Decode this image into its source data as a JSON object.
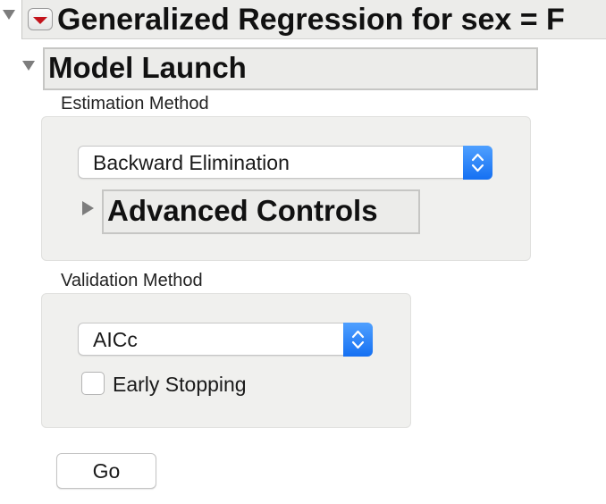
{
  "report": {
    "title": "Generalized Regression for sex = F",
    "menu_icon": "red-triangle-menu-icon",
    "disclosure_icon": "disclosure-triangle-expanded-icon"
  },
  "model_launch": {
    "title": "Model Launch",
    "estimation": {
      "label": "Estimation Method",
      "selected": "Backward Elimination"
    },
    "advanced_controls": {
      "title": "Advanced Controls",
      "state": "collapsed"
    },
    "validation": {
      "label": "Validation Method",
      "selected": "AICc",
      "early_stopping_label": "Early Stopping",
      "early_stopping_checked": false
    },
    "go_label": "Go"
  },
  "colors": {
    "header_background": "#ececea",
    "panel_background": "#f0f0ee",
    "stepper_blue": "#1570f2",
    "menu_red": "#c3141c",
    "disclosure_gray": "#7d7d7d"
  }
}
